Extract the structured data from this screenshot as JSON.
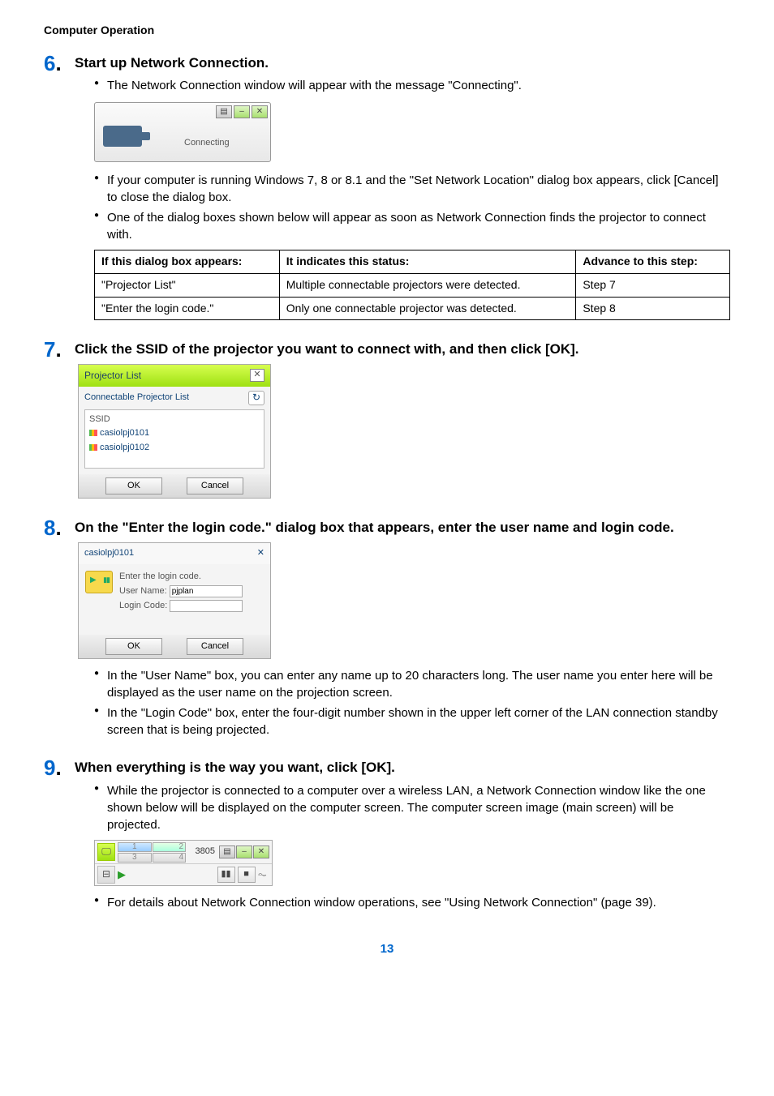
{
  "header": "Computer Operation",
  "page_number": "13",
  "steps": {
    "s6": {
      "num": "6",
      "title": "Start up Network Connection.",
      "b1": "The Network Connection window will appear with the message \"Connecting\".",
      "b2": "If your computer is running Windows 7, 8 or 8.1 and the \"Set Network Location\" dialog box appears, click [Cancel] to close the dialog box.",
      "b3": "One of the dialog boxes shown below will appear as soon as Network Connection finds the projector to connect with.",
      "connecting_label": "Connecting",
      "table": {
        "h1": "If this dialog box appears:",
        "h2": "It indicates this status:",
        "h3": "Advance to this step:",
        "r1c1": "\"Projector List\"",
        "r1c2": "Multiple connectable projectors were detected.",
        "r1c3": "Step 7",
        "r2c1": "\"Enter the login code.\"",
        "r2c2": "Only one connectable projector was detected.",
        "r2c3": "Step 8"
      }
    },
    "s7": {
      "num": "7",
      "title": "Click the SSID of the projector you want to connect with, and then click [OK].",
      "pl": {
        "title": "Projector List",
        "sub": "Connectable Projector List",
        "hdr": "SSID",
        "row1": "casiolpj0101",
        "row2": "casiolpj0102",
        "ok": "OK",
        "cancel": "Cancel"
      }
    },
    "s8": {
      "num": "8",
      "title": "On the \"Enter the login code.\" dialog box that appears, enter the user name and login code.",
      "login": {
        "title": "casiolpj0101",
        "prompt": "Enter the login code.",
        "un_label": "User Name:",
        "un_value": "pjplan",
        "lc_label": "Login Code:",
        "ok": "OK",
        "cancel": "Cancel"
      },
      "b1": "In the \"User Name\" box, you can enter any name up to 20 characters long. The user name you enter here will be displayed as the user name on the projection screen.",
      "b2": "In the \"Login Code\" box, enter the four-digit number shown in the upper left corner of the LAN connection standby screen that is being projected."
    },
    "s9": {
      "num": "9",
      "title": "When everything is the way you want, click [OK].",
      "b1": "While the projector is connected to a computer over a wireless LAN, a Network Connection window like the one shown below will be displayed on the computer screen. The computer screen image (main screen) will be projected.",
      "nc": {
        "code": "3805",
        "q1": "1",
        "q2": "2",
        "q3": "3",
        "q4": "4"
      },
      "b2": "For details about Network Connection window operations, see \"Using Network Connection\" (page 39)."
    }
  }
}
